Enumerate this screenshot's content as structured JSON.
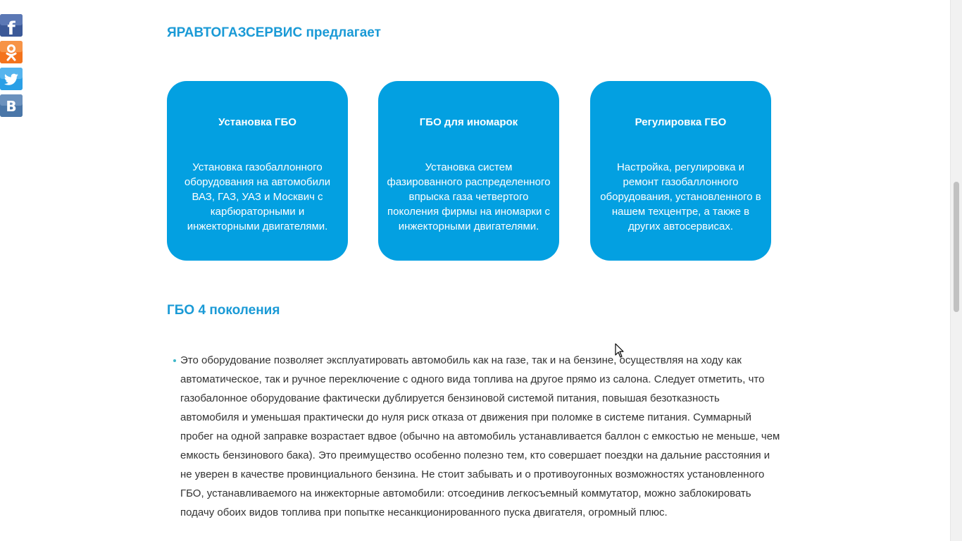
{
  "social": {
    "buttons": [
      {
        "network": "facebook",
        "icon": "facebook-icon",
        "color": "#3b5998",
        "glyph": "f"
      },
      {
        "network": "odnoklassniki",
        "icon": "odnoklassniki-icon",
        "color": "#f4731c"
      },
      {
        "network": "twitter",
        "icon": "twitter-icon",
        "color": "#2a9fe6"
      },
      {
        "network": "vkontakte",
        "icon": "vk-icon",
        "color": "#4a76a8",
        "glyph": "В"
      }
    ]
  },
  "offers": {
    "title": "ЯРАВТОГАЗСЕРВИС предлагает",
    "cards": [
      {
        "title": "Установка ГБО",
        "text": "Установка газобаллонного оборудования на автомобили ВАЗ, ГАЗ, УАЗ и Москвич с карбюраторными и инжекторными двигателями."
      },
      {
        "title": "ГБО для иномарок",
        "text": "Установка систем фазированного распределенного впрыска газа четвертого поколения фирмы на иномарки с инжекторными двигателями."
      },
      {
        "title": "Регулировка ГБО",
        "text": "Настройка, регулировка и ремонт газобаллонного оборудования, установленного в нашем техцентре, а также в других автосервисах."
      }
    ]
  },
  "gbo4": {
    "title": "ГБО 4 поколения",
    "items": [
      "Это оборудование позволяет эксплуатировать автомобиль как на газе, так и на бензине, осуществляя на ходу как автоматическое, так и ручное переключение с одного вида топлива на другое прямо из салона. Следует отметить, что газобалонное оборудование фактически дублируется бензиновой системой питания, повышая безотказность автомобиля и уменьшая практически до нуля риск отказа от движения при поломке в системе питания. Суммарный пробег на одной заправке возрастает вдвое (обычно на автомобиль устанавливается баллон с емкостью не меньше, чем емкость бензинового бака). Это преимущество особенно полезно тем, кто совершает поездки на дальние расстояния и не уверен в качестве провинциального бензина. Не стоит забывать и о противоугонных возможностях установленного ГБО, устанавливаемого на инжекторные автомобили: отсоединив легкосъемный коммутатор, можно заблокировать подачу обоих видов топлива при попытке несанкционированного пуска двигателя, огромный плюс."
    ]
  },
  "colors": {
    "accent": "#1a9ad6",
    "card_bg": "#03a0e1",
    "text": "#333333"
  }
}
